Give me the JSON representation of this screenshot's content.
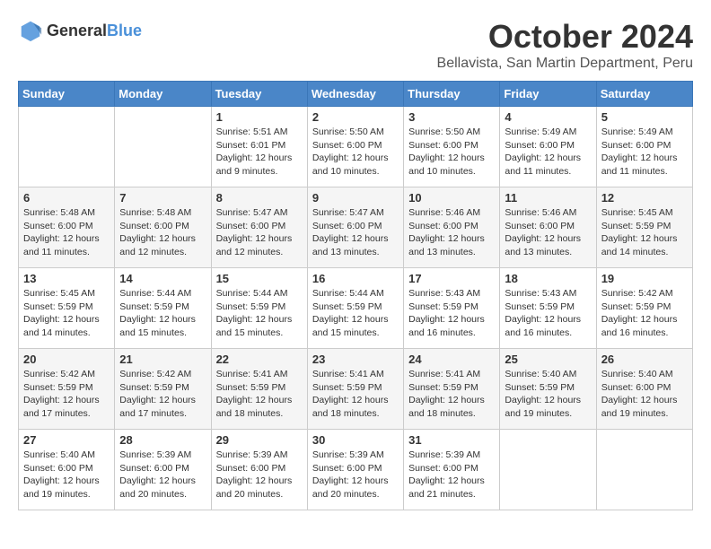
{
  "logo": {
    "text_general": "General",
    "text_blue": "Blue"
  },
  "title": "October 2024",
  "location": "Bellavista, San Martin Department, Peru",
  "days_of_week": [
    "Sunday",
    "Monday",
    "Tuesday",
    "Wednesday",
    "Thursday",
    "Friday",
    "Saturday"
  ],
  "weeks": [
    [
      {
        "day": "",
        "info": ""
      },
      {
        "day": "",
        "info": ""
      },
      {
        "day": "1",
        "info": "Sunrise: 5:51 AM\nSunset: 6:01 PM\nDaylight: 12 hours and 9 minutes."
      },
      {
        "day": "2",
        "info": "Sunrise: 5:50 AM\nSunset: 6:00 PM\nDaylight: 12 hours and 10 minutes."
      },
      {
        "day": "3",
        "info": "Sunrise: 5:50 AM\nSunset: 6:00 PM\nDaylight: 12 hours and 10 minutes."
      },
      {
        "day": "4",
        "info": "Sunrise: 5:49 AM\nSunset: 6:00 PM\nDaylight: 12 hours and 11 minutes."
      },
      {
        "day": "5",
        "info": "Sunrise: 5:49 AM\nSunset: 6:00 PM\nDaylight: 12 hours and 11 minutes."
      }
    ],
    [
      {
        "day": "6",
        "info": "Sunrise: 5:48 AM\nSunset: 6:00 PM\nDaylight: 12 hours and 11 minutes."
      },
      {
        "day": "7",
        "info": "Sunrise: 5:48 AM\nSunset: 6:00 PM\nDaylight: 12 hours and 12 minutes."
      },
      {
        "day": "8",
        "info": "Sunrise: 5:47 AM\nSunset: 6:00 PM\nDaylight: 12 hours and 12 minutes."
      },
      {
        "day": "9",
        "info": "Sunrise: 5:47 AM\nSunset: 6:00 PM\nDaylight: 12 hours and 13 minutes."
      },
      {
        "day": "10",
        "info": "Sunrise: 5:46 AM\nSunset: 6:00 PM\nDaylight: 12 hours and 13 minutes."
      },
      {
        "day": "11",
        "info": "Sunrise: 5:46 AM\nSunset: 6:00 PM\nDaylight: 12 hours and 13 minutes."
      },
      {
        "day": "12",
        "info": "Sunrise: 5:45 AM\nSunset: 5:59 PM\nDaylight: 12 hours and 14 minutes."
      }
    ],
    [
      {
        "day": "13",
        "info": "Sunrise: 5:45 AM\nSunset: 5:59 PM\nDaylight: 12 hours and 14 minutes."
      },
      {
        "day": "14",
        "info": "Sunrise: 5:44 AM\nSunset: 5:59 PM\nDaylight: 12 hours and 15 minutes."
      },
      {
        "day": "15",
        "info": "Sunrise: 5:44 AM\nSunset: 5:59 PM\nDaylight: 12 hours and 15 minutes."
      },
      {
        "day": "16",
        "info": "Sunrise: 5:44 AM\nSunset: 5:59 PM\nDaylight: 12 hours and 15 minutes."
      },
      {
        "day": "17",
        "info": "Sunrise: 5:43 AM\nSunset: 5:59 PM\nDaylight: 12 hours and 16 minutes."
      },
      {
        "day": "18",
        "info": "Sunrise: 5:43 AM\nSunset: 5:59 PM\nDaylight: 12 hours and 16 minutes."
      },
      {
        "day": "19",
        "info": "Sunrise: 5:42 AM\nSunset: 5:59 PM\nDaylight: 12 hours and 16 minutes."
      }
    ],
    [
      {
        "day": "20",
        "info": "Sunrise: 5:42 AM\nSunset: 5:59 PM\nDaylight: 12 hours and 17 minutes."
      },
      {
        "day": "21",
        "info": "Sunrise: 5:42 AM\nSunset: 5:59 PM\nDaylight: 12 hours and 17 minutes."
      },
      {
        "day": "22",
        "info": "Sunrise: 5:41 AM\nSunset: 5:59 PM\nDaylight: 12 hours and 18 minutes."
      },
      {
        "day": "23",
        "info": "Sunrise: 5:41 AM\nSunset: 5:59 PM\nDaylight: 12 hours and 18 minutes."
      },
      {
        "day": "24",
        "info": "Sunrise: 5:41 AM\nSunset: 5:59 PM\nDaylight: 12 hours and 18 minutes."
      },
      {
        "day": "25",
        "info": "Sunrise: 5:40 AM\nSunset: 5:59 PM\nDaylight: 12 hours and 19 minutes."
      },
      {
        "day": "26",
        "info": "Sunrise: 5:40 AM\nSunset: 6:00 PM\nDaylight: 12 hours and 19 minutes."
      }
    ],
    [
      {
        "day": "27",
        "info": "Sunrise: 5:40 AM\nSunset: 6:00 PM\nDaylight: 12 hours and 19 minutes."
      },
      {
        "day": "28",
        "info": "Sunrise: 5:39 AM\nSunset: 6:00 PM\nDaylight: 12 hours and 20 minutes."
      },
      {
        "day": "29",
        "info": "Sunrise: 5:39 AM\nSunset: 6:00 PM\nDaylight: 12 hours and 20 minutes."
      },
      {
        "day": "30",
        "info": "Sunrise: 5:39 AM\nSunset: 6:00 PM\nDaylight: 12 hours and 20 minutes."
      },
      {
        "day": "31",
        "info": "Sunrise: 5:39 AM\nSunset: 6:00 PM\nDaylight: 12 hours and 21 minutes."
      },
      {
        "day": "",
        "info": ""
      },
      {
        "day": "",
        "info": ""
      }
    ]
  ]
}
